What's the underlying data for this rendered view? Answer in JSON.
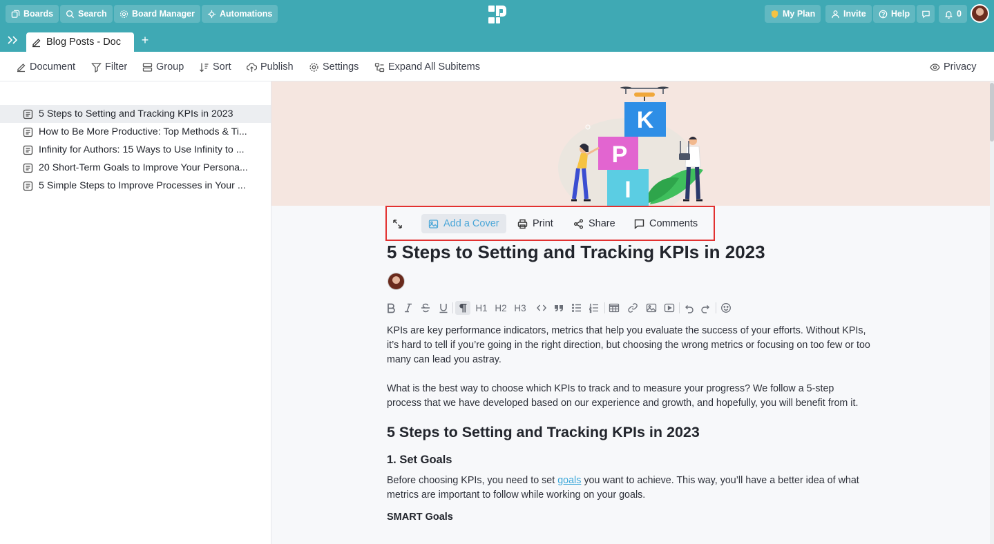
{
  "topbar": {
    "boards_label": "Boards",
    "search_label": "Search",
    "board_manager_label": "Board Manager",
    "automations_label": "Automations",
    "my_plan_label": "My Plan",
    "invite_label": "Invite",
    "help_label": "Help",
    "notifications_count": "0"
  },
  "tabs": {
    "active_tab_label": "Blog Posts - Doc",
    "add_tab_symbol": "+"
  },
  "toolbar": {
    "document_label": "Document",
    "filter_label": "Filter",
    "group_label": "Group",
    "sort_label": "Sort",
    "publish_label": "Publish",
    "settings_label": "Settings",
    "expand_label": "Expand All Subitems",
    "privacy_label": "Privacy"
  },
  "sidebar": {
    "items": [
      {
        "label": "5 Steps to Setting and Tracking KPIs in 2023"
      },
      {
        "label": "How to Be More Productive: Top Methods & Ti..."
      },
      {
        "label": "Infinity for Authors: 15 Ways to Use Infinity to ..."
      },
      {
        "label": "20 Short-Term Goals to Improve Your Persona..."
      },
      {
        "label": "5 Simple Steps to Improve Processes in Your ..."
      }
    ]
  },
  "cover": {
    "letters": [
      "K",
      "P",
      "I"
    ]
  },
  "actions": {
    "add_cover_label": "Add a Cover",
    "print_label": "Print",
    "share_label": "Share",
    "comments_label": "Comments"
  },
  "formatting": {
    "h1": "H1",
    "h2": "H2",
    "h3": "H3"
  },
  "document": {
    "title": "5 Steps to Setting and Tracking KPIs in 2023",
    "intro_p1": "KPIs are key performance indicators, metrics that help you evaluate the success of your efforts. Without KPIs, it’s hard to tell if you’re going in the right direction, but choosing the wrong metrics or focusing on too few or too many can lead you astray.",
    "intro_p2": "What is the best way to choose which KPIs to track and to measure your progress? We follow a 5-step process that we have developed based on our experience and growth, and hopefully, you will benefit from it.",
    "section_heading": "5 Steps to Setting and Tracking KPIs in 2023",
    "step1_heading": "1. Set Goals",
    "step1_before_link": "Before choosing KPIs, you need to set ",
    "step1_link": "goals",
    "step1_after_link": " you want to achieve. This way, you’ll have a better idea of what metrics are important to follow while working on your goals.",
    "smart_heading": "SMART Goals"
  },
  "colors": {
    "brand_teal": "#3fa9b4",
    "highlight_red": "#e23130",
    "link_blue": "#3aa6d8"
  }
}
